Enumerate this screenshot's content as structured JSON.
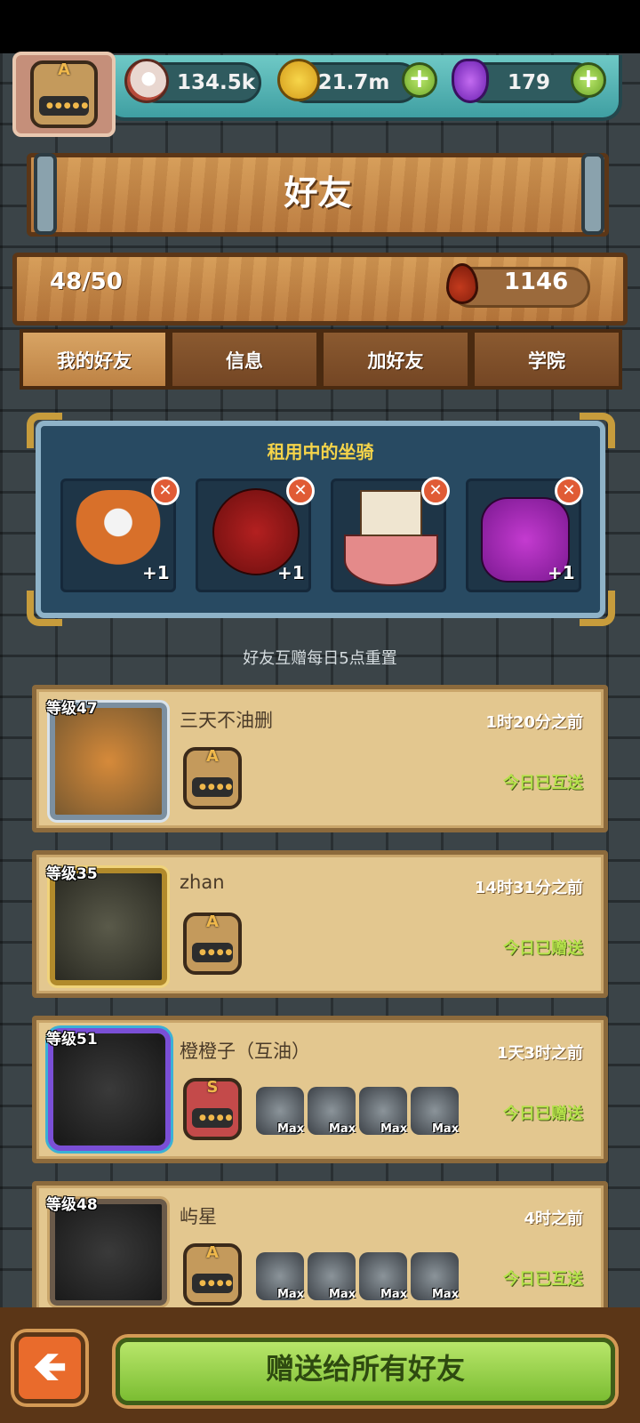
{
  "resources": {
    "eyeball": {
      "icon": "eyeball-icon",
      "value": "134.5k"
    },
    "coins": {
      "icon": "gold-coin-icon",
      "value": "21.7m",
      "plus": "+"
    },
    "potion": {
      "icon": "purple-potion-icon",
      "value": "179",
      "plus": "+"
    }
  },
  "player_badge": {
    "letter": "A"
  },
  "title": "好友",
  "friend_count": "48/50",
  "blood_drop": {
    "icon": "blood-drop-icon",
    "value": "1146"
  },
  "tabs": [
    {
      "label": "我的好友",
      "active": true
    },
    {
      "label": "信息",
      "active": false
    },
    {
      "label": "加好友",
      "active": false
    },
    {
      "label": "学院",
      "active": false
    }
  ],
  "rented_mounts": {
    "title": "租用中的坐骑",
    "slots": [
      {
        "icon": "lion-dance-mount-icon",
        "bonus": "+1"
      },
      {
        "icon": "red-rose-mount-icon",
        "bonus": "+1"
      },
      {
        "icon": "viking-ship-mount-icon",
        "bonus": ""
      },
      {
        "icon": "purple-demon-mount-icon",
        "bonus": "+1"
      }
    ]
  },
  "notice": "好友互赠每日5点重置",
  "friends": [
    {
      "level": "等级47",
      "name": "三天不油删",
      "time": "1时20分之前",
      "status": "今日已互送",
      "badge": "A",
      "mounts": []
    },
    {
      "level": "等级35",
      "name": "zhan",
      "time": "14时31分之前",
      "status": "今日已赠送",
      "badge": "A",
      "mounts": []
    },
    {
      "level": "等级51",
      "name": "橙橙子（互油）",
      "time": "1天3时之前",
      "status": "今日已赠送",
      "badge": "S",
      "mounts": [
        "Max",
        "Max",
        "Max",
        "Max"
      ]
    },
    {
      "level": "等级48",
      "name": "屿星",
      "time": "4时之前",
      "status": "今日已互送",
      "badge": "A",
      "mounts": [
        "Max",
        "Max",
        "Max",
        "Max"
      ]
    }
  ],
  "buttons": {
    "back": "🡸",
    "gift_all": "赠送给所有好友"
  }
}
